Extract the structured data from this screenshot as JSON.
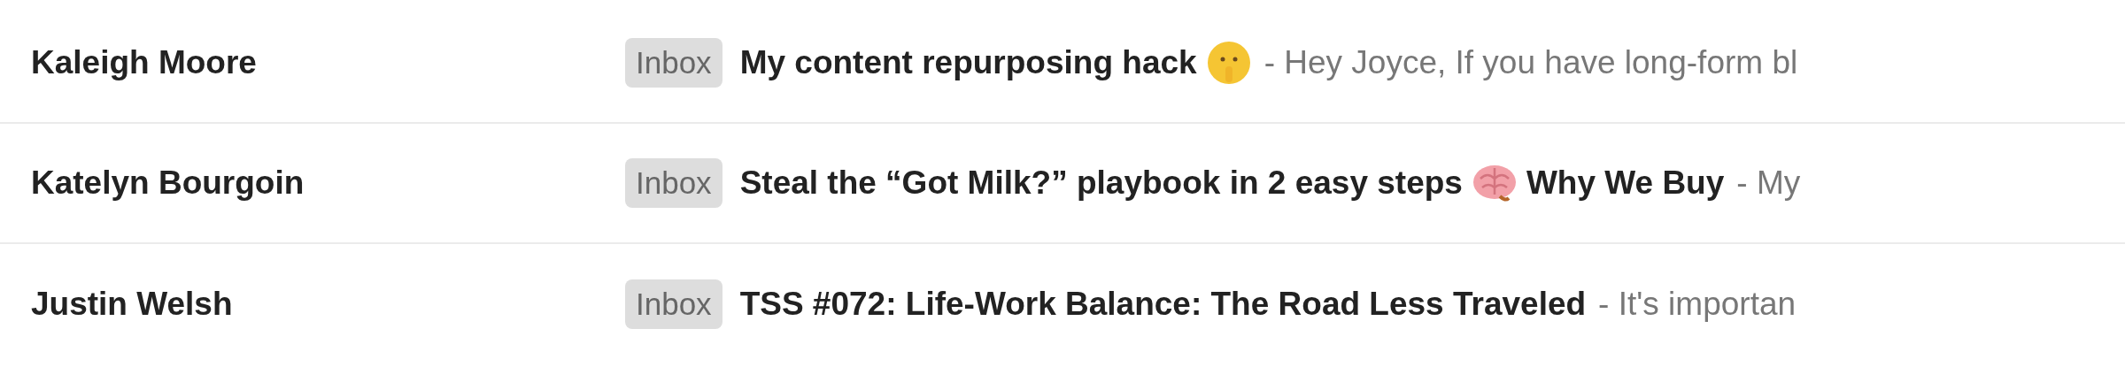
{
  "messages": [
    {
      "sender": "Kaleigh Moore",
      "label": "Inbox",
      "subject": [
        {
          "kind": "text",
          "text": "My content repurposing hack"
        },
        {
          "kind": "shush-emoji"
        }
      ],
      "snippet": "- Hey Joyce, If you have long-form bl"
    },
    {
      "sender": "Katelyn Bourgoin",
      "label": "Inbox",
      "subject": [
        {
          "kind": "text",
          "text": "Steal the “Got Milk?” playbook in 2 easy steps"
        },
        {
          "kind": "brain-emoji"
        },
        {
          "kind": "text",
          "text": "Why We Buy"
        }
      ],
      "snippet": "- My"
    },
    {
      "sender": "Justin Welsh",
      "label": "Inbox",
      "subject": [
        {
          "kind": "text",
          "text": "TSS #072: Life-Work Balance: The Road Less Traveled"
        }
      ],
      "snippet": "- It's importan"
    }
  ]
}
